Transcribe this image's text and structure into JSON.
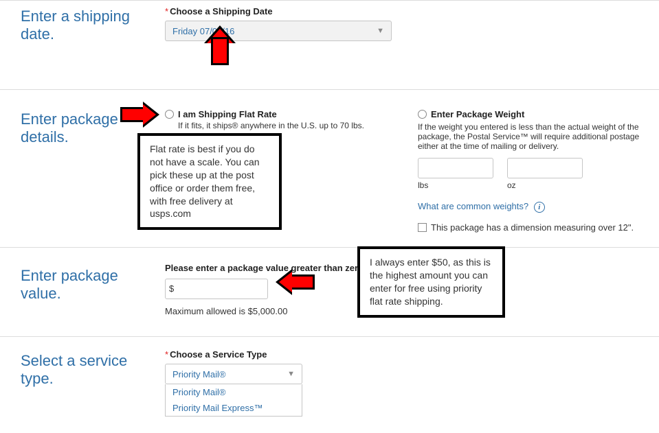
{
  "section1": {
    "title": "Enter a shipping date.",
    "label": "Choose a Shipping Date",
    "value": "Friday 07/08/16"
  },
  "section2": {
    "title": "Enter package details.",
    "flat": {
      "label": "I am Shipping Flat Rate",
      "sub": "If it fits, it ships® anywhere in the U.S. up to 70 lbs."
    },
    "weight": {
      "label": "Enter Package Weight",
      "sub": "If the weight you entered is less than the actual weight of the package, the Postal Service™ will require additional postage either at the time of mailing or delivery.",
      "lbs": "lbs",
      "oz": "oz",
      "commonlink": "What are common weights?",
      "over12": "This package has a dimension measuring over 12\"."
    },
    "annot": "Flat rate is best if you do not have a scale. You can pick these up at the post office or order them free, with free delivery at usps.com"
  },
  "section3": {
    "title": "Enter package value.",
    "label": "Please enter a package value greater than zero.",
    "currency": "$",
    "max": "Maximum allowed is $5,000.00",
    "annot": "I always enter $50, as this is the highest amount you can enter for free using priority flat rate shipping."
  },
  "section4": {
    "title": "Select a service type.",
    "label": "Choose a Service Type",
    "value": "Priority Mail®",
    "options": [
      "Priority Mail®",
      "Priority Mail Express™"
    ]
  }
}
